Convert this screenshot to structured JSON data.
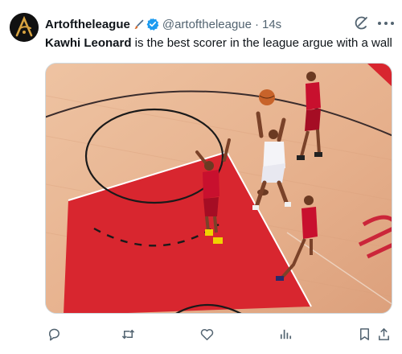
{
  "tweet": {
    "display_name": "Artoftheleague",
    "brush_icon": "paintbrush-icon",
    "verified_icon": "verified-badge-icon",
    "handle": "@artoftheleague",
    "separator": "·",
    "timestamp": "14s",
    "text_mention": "Kawhi Leonard",
    "text_rest": " is the best scorer in the league argue with a wall",
    "avatar_icon": "league-logo-avatar",
    "avatar_letter": "A"
  },
  "header_icons": [
    "grok-icon",
    "more-icon"
  ],
  "media": {
    "description_icon": "basketball-court-photo"
  },
  "actions": [
    {
      "name": "reply-icon"
    },
    {
      "name": "retweet-icon"
    },
    {
      "name": "like-icon"
    },
    {
      "name": "views-icon"
    },
    {
      "name": "bookmark-icon"
    },
    {
      "name": "share-icon"
    }
  ],
  "colors": {
    "verified": "#1d9bf0",
    "text": "#0f1419",
    "secondary": "#536471",
    "court_wood": "#e7b695",
    "court_paint": "#d8262f",
    "rockets_red": "#c8102e"
  }
}
